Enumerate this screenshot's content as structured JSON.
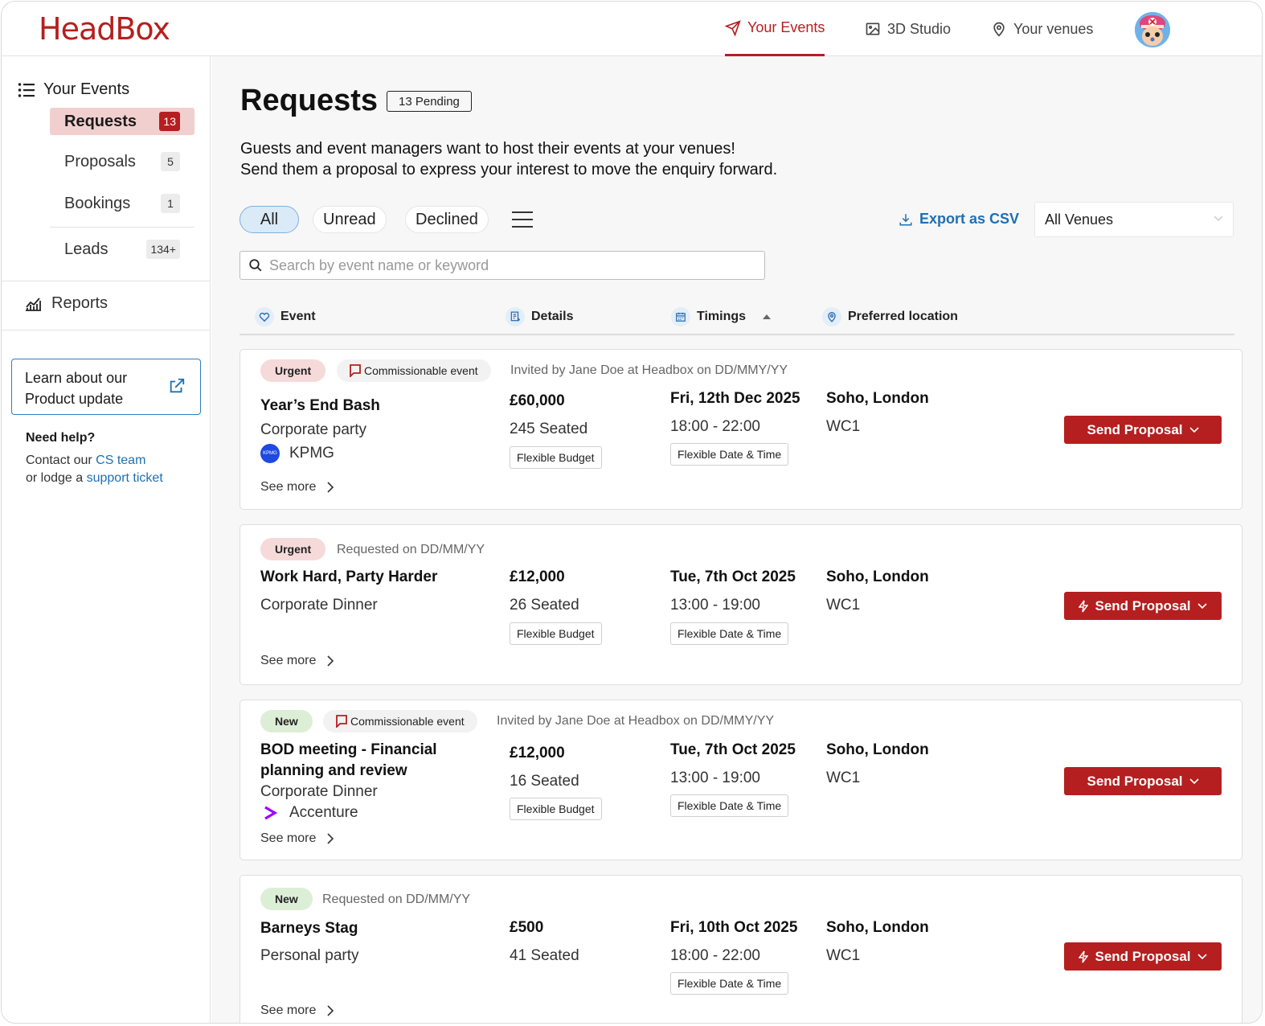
{
  "header": {
    "logo": "HeadBox",
    "nav": [
      {
        "label": "Your Events",
        "icon": "paper-plane-icon",
        "active": true
      },
      {
        "label": "3D Studio",
        "icon": "image-icon",
        "active": false
      },
      {
        "label": "Your venues",
        "icon": "location-pin-icon",
        "active": false
      }
    ],
    "accent_color": "#b51f1f"
  },
  "sidebar": {
    "heading": "Your Events",
    "items": [
      {
        "label": "Requests",
        "count": "13",
        "active": true
      },
      {
        "label": "Proposals",
        "count": "5",
        "active": false
      },
      {
        "label": "Bookings",
        "count": "1",
        "active": false
      },
      {
        "label": "Leads",
        "count": "134+",
        "active": false
      }
    ],
    "reports": "Reports",
    "learn_line1": "Learn about our",
    "learn_line2": "Product update",
    "help_title": "Need help?",
    "help_line1_prefix": "Contact our ",
    "help_line1_link": "CS team",
    "help_line2_prefix": "or lodge a ",
    "help_line2_link": "support ticket"
  },
  "main": {
    "title": "Requests",
    "pending_badge": "13 Pending",
    "intro_line1": "Guests and event managers want to host their events at your venues!",
    "intro_line2": "Send them a proposal to express your interest to move the enquiry forward.",
    "filters": [
      {
        "label": "All",
        "active": true
      },
      {
        "label": "Unread",
        "active": false
      },
      {
        "label": "Declined",
        "active": false
      }
    ],
    "export_label": "Export as CSV",
    "venue_select": "All Venues",
    "search_placeholder": "Search by event name or keyword",
    "columns": {
      "event": "Event",
      "details": "Details",
      "timings": "Timings",
      "location": "Preferred location"
    }
  },
  "requests": [
    {
      "tag": "Urgent",
      "commissionable": "Commissionable event",
      "meta": "Invited by Jane Doe at Headbox on DD/MMY/YY",
      "name": "Year’s End Bash",
      "type": "Corporate party",
      "company": "KPMG",
      "see_more": "See more",
      "price": "£60,000",
      "seated": "245 Seated",
      "budget_chip": "Flexible Budget",
      "date": "Fri, 12th Dec 2025",
      "time": "18:00 - 22:00",
      "time_chip": "Flexible Date & Time",
      "location": "Soho, London",
      "postcode": "WC1",
      "action": "Send Proposal"
    },
    {
      "tag": "Urgent",
      "meta": "Requested on DD/MM/YY",
      "name": "Work Hard, Party Harder",
      "type": "Corporate Dinner",
      "see_more": "See more",
      "price": "£12,000",
      "seated": "26 Seated",
      "budget_chip": "Flexible Budget",
      "date": "Tue, 7th Oct 2025",
      "time": "13:00 - 19:00",
      "time_chip": "Flexible Date & Time",
      "location": "Soho, London",
      "postcode": "WC1",
      "action": "Send Proposal"
    },
    {
      "tag": "New",
      "commissionable": "Commissionable event",
      "meta": "Invited by Jane Doe at Headbox on DD/MMY/YY",
      "name_line1": "BOD meeting - Financial",
      "name_line2": "planning and review",
      "type": "Corporate Dinner",
      "company": "Accenture",
      "see_more": "See more",
      "price": "£12,000",
      "seated": "16 Seated",
      "budget_chip": "Flexible Budget",
      "date": "Tue, 7th Oct 2025",
      "time": "13:00 - 19:00",
      "time_chip": "Flexible Date & Time",
      "location": "Soho, London",
      "postcode": "WC1",
      "action": "Send Proposal"
    },
    {
      "tag": "New",
      "meta": "Requested on DD/MM/YY",
      "name": "Barneys Stag",
      "type": "Personal party",
      "see_more": "See more",
      "price": "£500",
      "seated": "41 Seated",
      "date": "Fri, 10th Oct 2025",
      "time": "18:00 - 22:00",
      "time_chip": "Flexible Date & Time",
      "location": "Soho, London",
      "postcode": "WC1",
      "action": "Send Proposal"
    }
  ]
}
